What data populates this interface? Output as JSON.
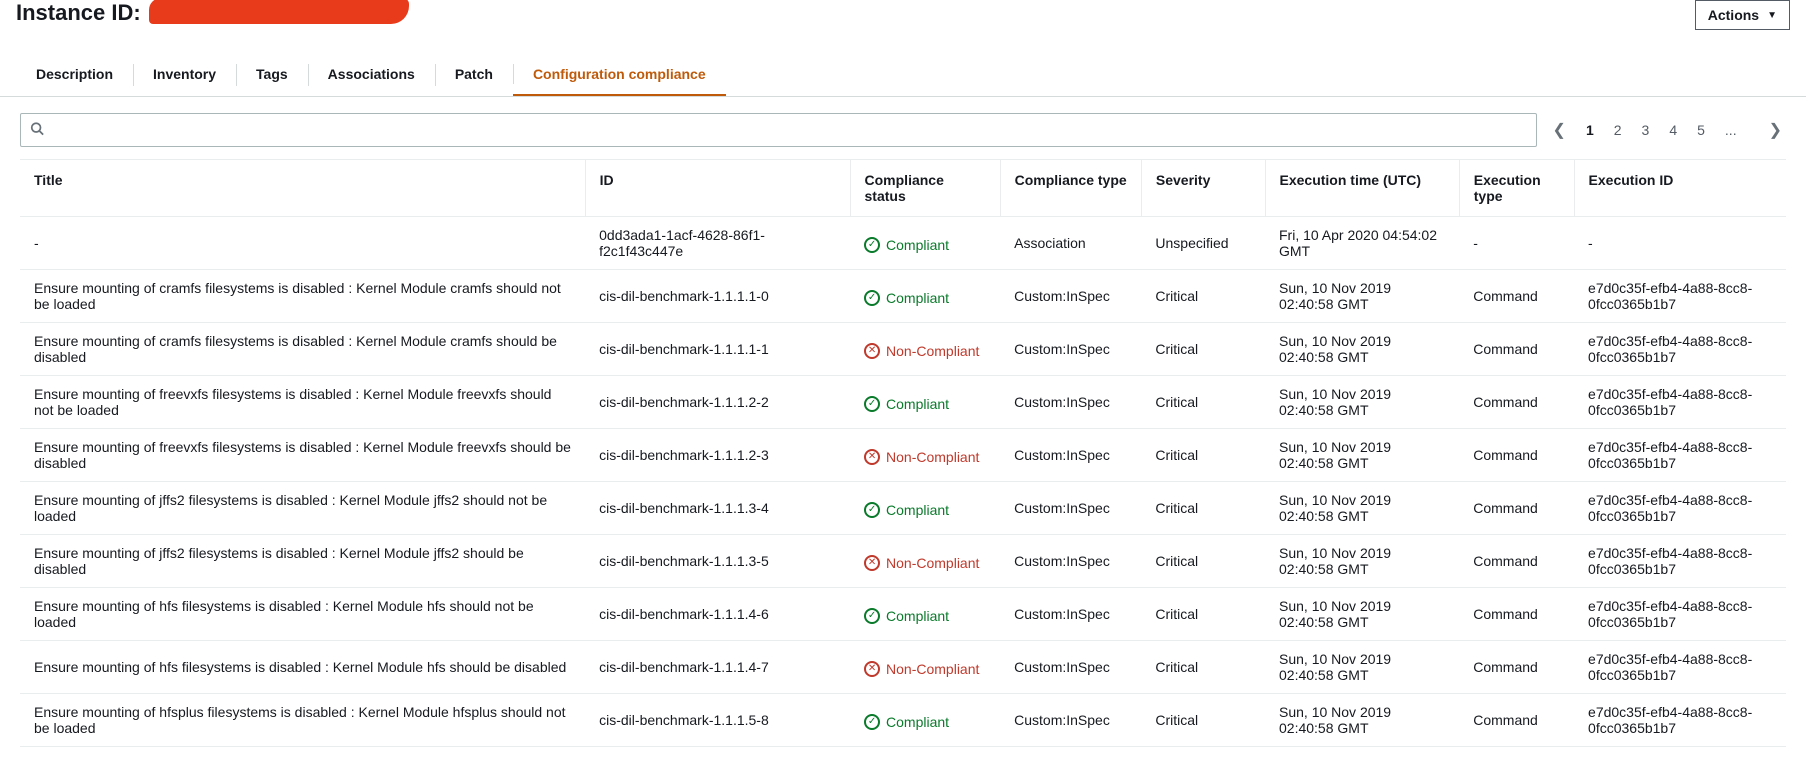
{
  "header": {
    "page_title_prefix": "Instance ID:",
    "actions_label": "Actions"
  },
  "tabs": [
    {
      "label": "Description",
      "active": false
    },
    {
      "label": "Inventory",
      "active": false
    },
    {
      "label": "Tags",
      "active": false
    },
    {
      "label": "Associations",
      "active": false
    },
    {
      "label": "Patch",
      "active": false
    },
    {
      "label": "Configuration compliance",
      "active": true
    }
  ],
  "search": {
    "value": ""
  },
  "pagination": {
    "pages": [
      "1",
      "2",
      "3",
      "4",
      "5",
      "..."
    ],
    "current": "1"
  },
  "table": {
    "columns": [
      "Title",
      "ID",
      "Compliance status",
      "Compliance type",
      "Severity",
      "Execution time (UTC)",
      "Execution type",
      "Execution ID"
    ],
    "rows": [
      {
        "title": "-",
        "id": "0dd3ada1-1acf-4628-86f1-f2c1f43c447e",
        "status": "Compliant",
        "type": "Association",
        "severity": "Unspecified",
        "time": "Fri, 10 Apr 2020 04:54:02 GMT",
        "exectype": "-",
        "execid": "-"
      },
      {
        "title": "Ensure mounting of cramfs filesystems is disabled : Kernel Module cramfs should not be loaded",
        "id": "cis-dil-benchmark-1.1.1.1-0",
        "status": "Compliant",
        "type": "Custom:InSpec",
        "severity": "Critical",
        "time": "Sun, 10 Nov 2019 02:40:58 GMT",
        "exectype": "Command",
        "execid": "e7d0c35f-efb4-4a88-8cc8-0fcc0365b1b7"
      },
      {
        "title": "Ensure mounting of cramfs filesystems is disabled : Kernel Module cramfs should be disabled",
        "id": "cis-dil-benchmark-1.1.1.1-1",
        "status": "Non-Compliant",
        "type": "Custom:InSpec",
        "severity": "Critical",
        "time": "Sun, 10 Nov 2019 02:40:58 GMT",
        "exectype": "Command",
        "execid": "e7d0c35f-efb4-4a88-8cc8-0fcc0365b1b7"
      },
      {
        "title": "Ensure mounting of freevxfs filesystems is disabled : Kernel Module freevxfs should not be loaded",
        "id": "cis-dil-benchmark-1.1.1.2-2",
        "status": "Compliant",
        "type": "Custom:InSpec",
        "severity": "Critical",
        "time": "Sun, 10 Nov 2019 02:40:58 GMT",
        "exectype": "Command",
        "execid": "e7d0c35f-efb4-4a88-8cc8-0fcc0365b1b7"
      },
      {
        "title": "Ensure mounting of freevxfs filesystems is disabled : Kernel Module freevxfs should be disabled",
        "id": "cis-dil-benchmark-1.1.1.2-3",
        "status": "Non-Compliant",
        "type": "Custom:InSpec",
        "severity": "Critical",
        "time": "Sun, 10 Nov 2019 02:40:58 GMT",
        "exectype": "Command",
        "execid": "e7d0c35f-efb4-4a88-8cc8-0fcc0365b1b7"
      },
      {
        "title": "Ensure mounting of jffs2 filesystems is disabled : Kernel Module jffs2 should not be loaded",
        "id": "cis-dil-benchmark-1.1.1.3-4",
        "status": "Compliant",
        "type": "Custom:InSpec",
        "severity": "Critical",
        "time": "Sun, 10 Nov 2019 02:40:58 GMT",
        "exectype": "Command",
        "execid": "e7d0c35f-efb4-4a88-8cc8-0fcc0365b1b7"
      },
      {
        "title": "Ensure mounting of jffs2 filesystems is disabled : Kernel Module jffs2 should be disabled",
        "id": "cis-dil-benchmark-1.1.1.3-5",
        "status": "Non-Compliant",
        "type": "Custom:InSpec",
        "severity": "Critical",
        "time": "Sun, 10 Nov 2019 02:40:58 GMT",
        "exectype": "Command",
        "execid": "e7d0c35f-efb4-4a88-8cc8-0fcc0365b1b7"
      },
      {
        "title": "Ensure mounting of hfs filesystems is disabled : Kernel Module hfs should not be loaded",
        "id": "cis-dil-benchmark-1.1.1.4-6",
        "status": "Compliant",
        "type": "Custom:InSpec",
        "severity": "Critical",
        "time": "Sun, 10 Nov 2019 02:40:58 GMT",
        "exectype": "Command",
        "execid": "e7d0c35f-efb4-4a88-8cc8-0fcc0365b1b7"
      },
      {
        "title": "Ensure mounting of hfs filesystems is disabled : Kernel Module hfs should be disabled",
        "id": "cis-dil-benchmark-1.1.1.4-7",
        "status": "Non-Compliant",
        "type": "Custom:InSpec",
        "severity": "Critical",
        "time": "Sun, 10 Nov 2019 02:40:58 GMT",
        "exectype": "Command",
        "execid": "e7d0c35f-efb4-4a88-8cc8-0fcc0365b1b7"
      },
      {
        "title": "Ensure mounting of hfsplus filesystems is disabled : Kernel Module hfsplus should not be loaded",
        "id": "cis-dil-benchmark-1.1.1.5-8",
        "status": "Compliant",
        "type": "Custom:InSpec",
        "severity": "Critical",
        "time": "Sun, 10 Nov 2019 02:40:58 GMT",
        "exectype": "Command",
        "execid": "e7d0c35f-efb4-4a88-8cc8-0fcc0365b1b7"
      }
    ]
  }
}
